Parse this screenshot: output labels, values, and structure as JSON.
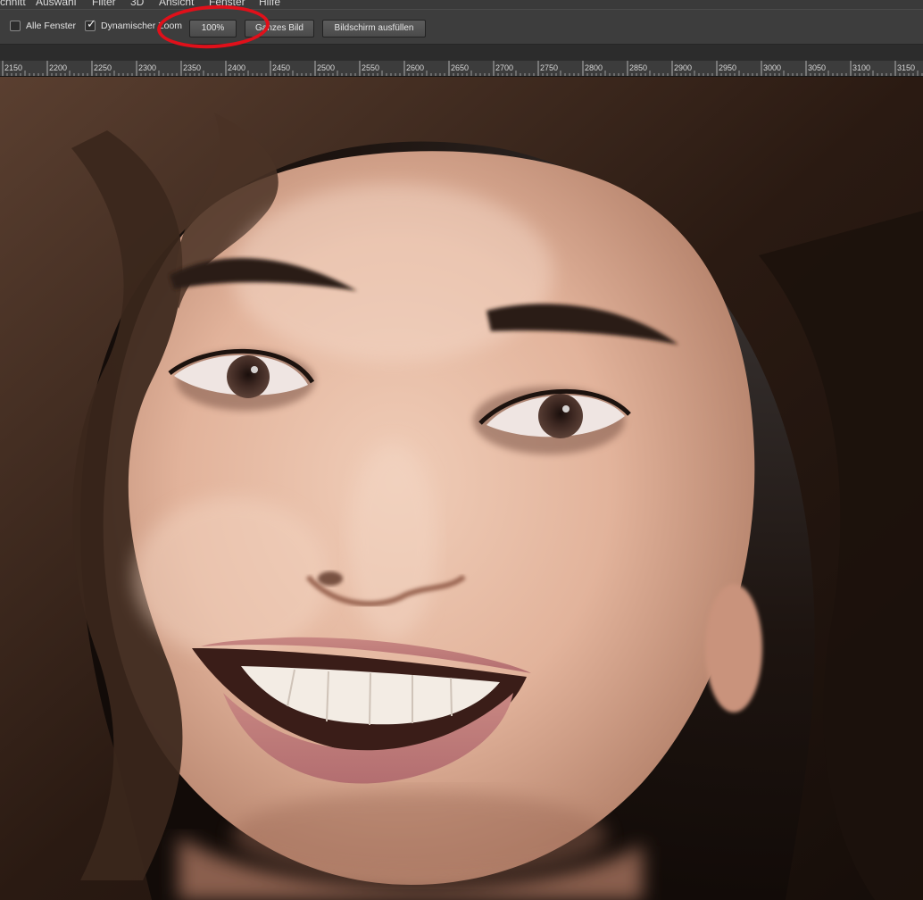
{
  "menubar": {
    "items": [
      {
        "label": "chnitt"
      },
      {
        "label": "Auswahl"
      },
      {
        "label": "Filter"
      },
      {
        "label": "3D"
      },
      {
        "label": "Ansicht"
      },
      {
        "label": "Fenster"
      },
      {
        "label": "Hilfe"
      }
    ]
  },
  "options": {
    "all_windows": {
      "label": "Alle Fenster",
      "checked": false
    },
    "dynamic_zoom": {
      "label": "Dynamischer Zoom",
      "checked": true
    },
    "zoom_100": {
      "label": "100%"
    },
    "fit_screen": {
      "label": "Ganzes Bild"
    },
    "fill_screen": {
      "label": "Bildschirm ausfüllen"
    }
  },
  "highlight": {
    "color": "#e0101a",
    "target": "zoom-100-button"
  },
  "ruler": {
    "labels": [
      "2150",
      "2200",
      "2250",
      "2300",
      "2350",
      "2400",
      "2450",
      "2500",
      "2550",
      "2600",
      "2650",
      "2700",
      "2750",
      "2800",
      "2850",
      "2900",
      "2950",
      "3000",
      "3050",
      "3100",
      "3150"
    ]
  },
  "canvas": {
    "subject": "close-up-photo-smiling-woman",
    "colors": {
      "skin": "#e6b8a1",
      "hair": "#2b1c14",
      "background": "#1a120d",
      "lips": "#c4797a"
    }
  }
}
